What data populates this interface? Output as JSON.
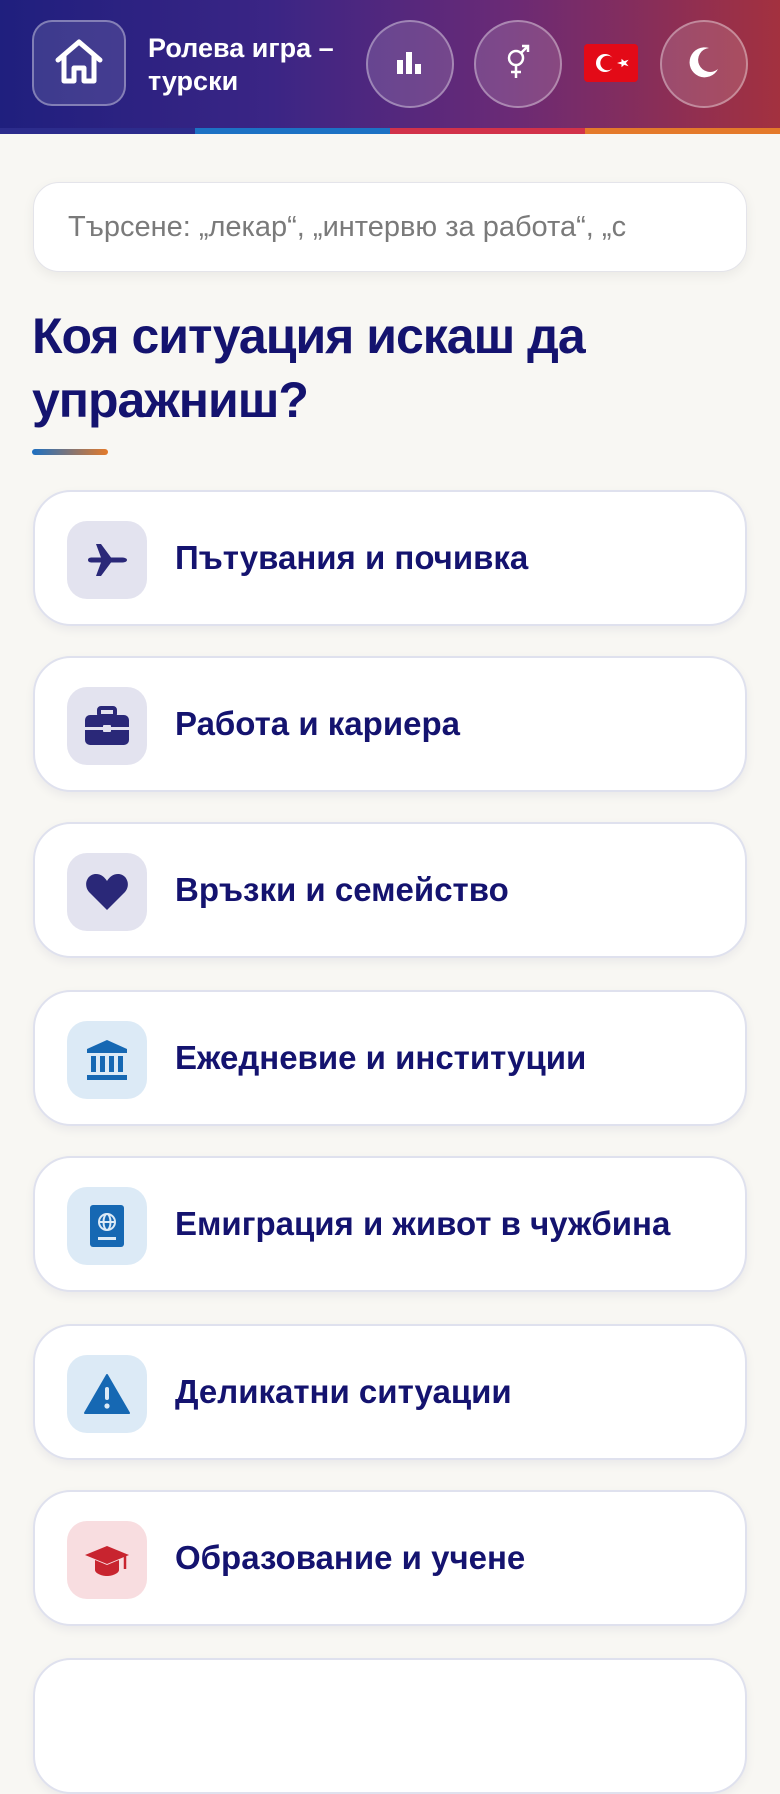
{
  "header": {
    "title": "Ролева игра – турски",
    "home_icon": "home-icon",
    "stats_icon": "bar-chart-icon",
    "gender_icon": "gender-icon",
    "flag_icon": "turkey-flag-icon",
    "theme_icon": "moon-icon",
    "stripe_colors": [
      "#2c2c8c",
      "#1d72c4",
      "#d2324a",
      "#e47a2a"
    ]
  },
  "search": {
    "placeholder": "Търсене: „лекар“, „интервю за работа“, „с"
  },
  "main": {
    "heading": "Коя ситуация искаш да упражниш?"
  },
  "categories": [
    {
      "label": "Пътувания и почивка",
      "icon": "airplane-icon",
      "icon_color": "#2a2878",
      "icon_bg": "#e3e3ef"
    },
    {
      "label": "Работа и кариера",
      "icon": "briefcase-icon",
      "icon_color": "#2a2878",
      "icon_bg": "#e3e3ef"
    },
    {
      "label": "Връзки и семейство",
      "icon": "heart-icon",
      "icon_color": "#2a2878",
      "icon_bg": "#e3e3ef"
    },
    {
      "label": "Ежедневие и институции",
      "icon": "institution-icon",
      "icon_color": "#1668b3",
      "icon_bg": "#dceaf6"
    },
    {
      "label": "Емиграция и живот в чужбина",
      "icon": "passport-icon",
      "icon_color": "#1668b3",
      "icon_bg": "#dceaf6"
    },
    {
      "label": "Деликатни ситуации",
      "icon": "warning-icon",
      "icon_color": "#1668b3",
      "icon_bg": "#dceaf6"
    },
    {
      "label": "Образование и учене",
      "icon": "graduation-cap-icon",
      "icon_color": "#c8242f",
      "icon_bg": "#f8dde0"
    }
  ]
}
